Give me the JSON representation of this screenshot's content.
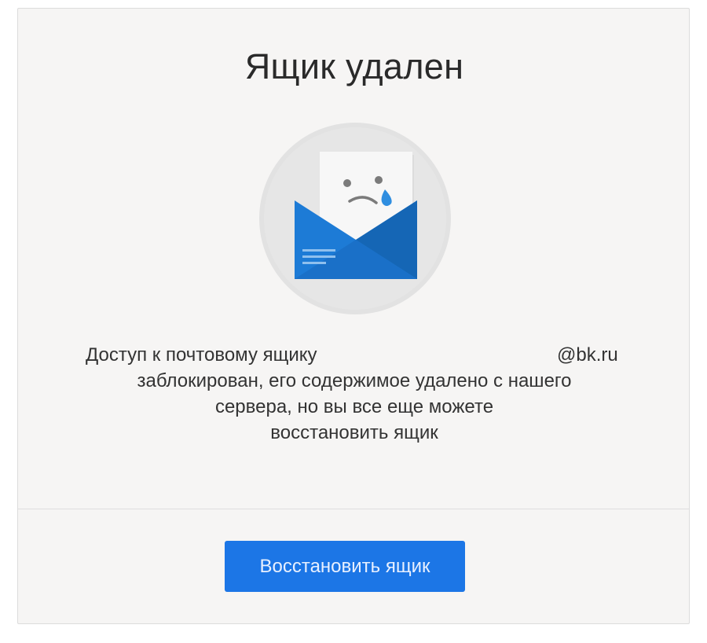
{
  "dialog": {
    "title": "Ящик удален",
    "message": {
      "line1_prefix": "Доступ к почтовому ящику",
      "email_name": "",
      "line1_domain": "@bk.ru",
      "line2": "заблокирован, его содержимое удалено с нашего",
      "line3": "сервера, но вы все еще можете",
      "line4": "восстановить ящик"
    },
    "restore_button_label": "Восстановить ящик"
  },
  "illustration": {
    "icon": "sad-envelope-icon",
    "colors": {
      "circle": "#e2e2e2",
      "envelope": "#1d7bd6",
      "envelope_dark": "#1566b5",
      "letter": "#f7f7f7",
      "tear": "#2f8ee0"
    }
  },
  "colors": {
    "accent": "#1c76e6",
    "background": "#f6f5f4",
    "text": "#333333"
  }
}
